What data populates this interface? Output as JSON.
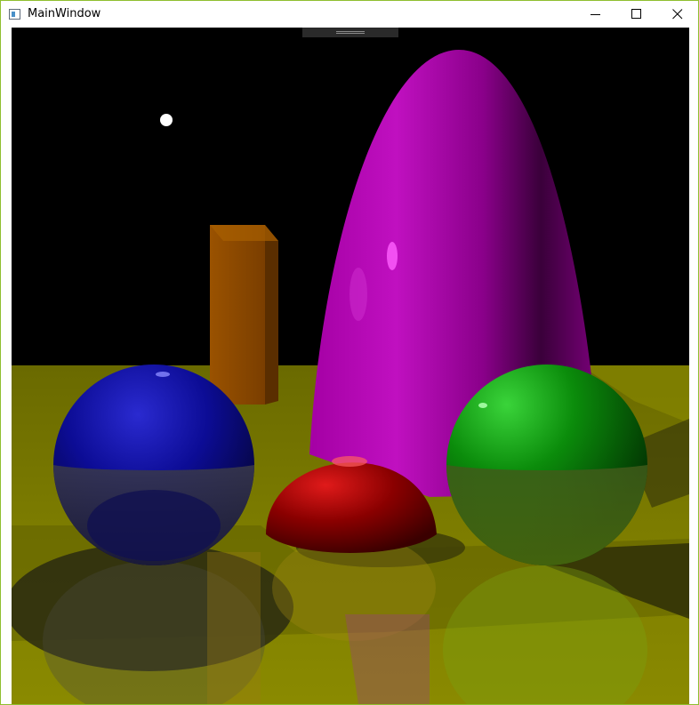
{
  "window": {
    "title": "MainWindow",
    "frame_color": "#8fbf2f"
  },
  "titlebar": {
    "icon": "window-app-icon",
    "controls": [
      {
        "name": "minimize",
        "icon": "minimize-icon"
      },
      {
        "name": "maximize",
        "icon": "maximize-icon"
      },
      {
        "name": "close",
        "icon": "close-icon"
      }
    ]
  },
  "render": {
    "background_color": "#000000",
    "floor_color": "#6e6e00",
    "objects": [
      {
        "name": "blue-sphere",
        "color": "#0a0a8c"
      },
      {
        "name": "red-hemisphere",
        "color": "#8c0000"
      },
      {
        "name": "green-sphere",
        "color": "#0a8c0a"
      },
      {
        "name": "magenta-paraboloid",
        "color": "#a000a0"
      },
      {
        "name": "orange-box",
        "color": "#8a4a00"
      },
      {
        "name": "light-source",
        "color": "#ffffff"
      }
    ]
  }
}
